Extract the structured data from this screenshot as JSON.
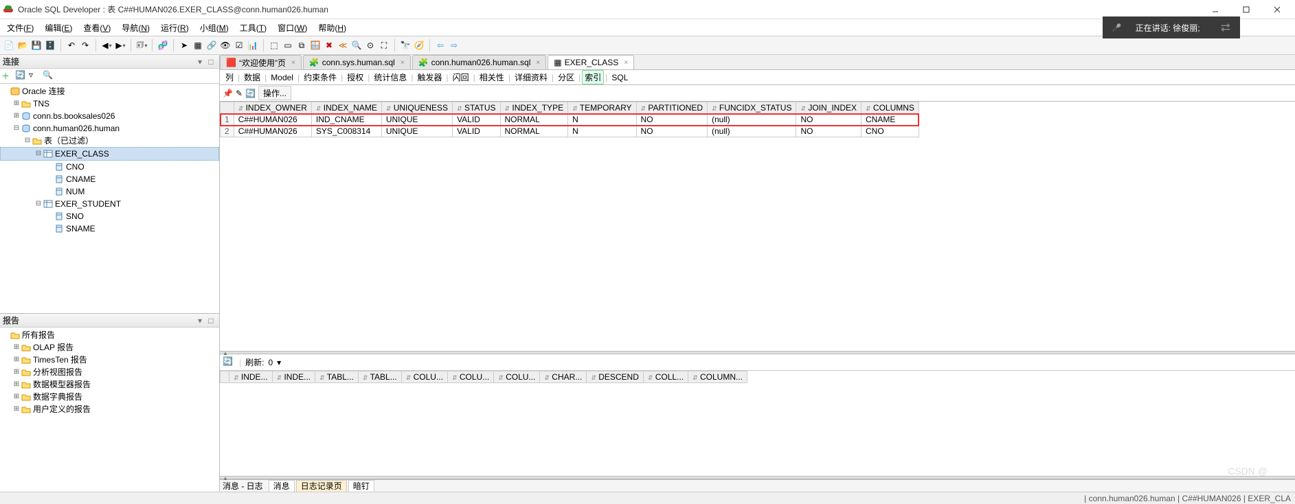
{
  "window": {
    "title": "Oracle SQL Developer : 表 C##HUMAN026.EXER_CLASS@conn.human026.human"
  },
  "speaking": {
    "label": "正在讲话: 徐俊丽;"
  },
  "menubar": [
    {
      "label": "文件",
      "ul": "F"
    },
    {
      "label": "编辑",
      "ul": "E"
    },
    {
      "label": "查看",
      "ul": "V"
    },
    {
      "label": "导航",
      "ul": "N"
    },
    {
      "label": "运行",
      "ul": "R"
    },
    {
      "label": "小组",
      "ul": "M"
    },
    {
      "label": "工具",
      "ul": "T"
    },
    {
      "label": "窗口",
      "ul": "W"
    },
    {
      "label": "帮助",
      "ul": "H"
    }
  ],
  "leftTop": {
    "title": "连接",
    "tree": [
      {
        "pad": 0,
        "tw": "",
        "ic": "conn",
        "label": "Oracle 连接"
      },
      {
        "pad": 1,
        "tw": "+",
        "ic": "folder",
        "label": "TNS"
      },
      {
        "pad": 1,
        "tw": "+",
        "ic": "db",
        "label": "conn.bs.booksales026"
      },
      {
        "pad": 1,
        "tw": "-",
        "ic": "db",
        "label": "conn.human026.human"
      },
      {
        "pad": 2,
        "tw": "-",
        "ic": "folder",
        "label": "表（已过滤）"
      },
      {
        "pad": 3,
        "tw": "-",
        "ic": "table",
        "label": "EXER_CLASS",
        "sel": true
      },
      {
        "pad": 4,
        "tw": "",
        "ic": "col",
        "label": "CNO"
      },
      {
        "pad": 4,
        "tw": "",
        "ic": "col",
        "label": "CNAME"
      },
      {
        "pad": 4,
        "tw": "",
        "ic": "col",
        "label": "NUM"
      },
      {
        "pad": 3,
        "tw": "-",
        "ic": "table",
        "label": "EXER_STUDENT"
      },
      {
        "pad": 4,
        "tw": "",
        "ic": "col",
        "label": "SNO"
      },
      {
        "pad": 4,
        "tw": "",
        "ic": "col",
        "label": "SNAME"
      }
    ]
  },
  "leftBot": {
    "title": "报告",
    "tree": [
      {
        "pad": 0,
        "tw": "",
        "ic": "folder",
        "label": "所有报告"
      },
      {
        "pad": 1,
        "tw": "+",
        "ic": "folder",
        "label": "OLAP 报告"
      },
      {
        "pad": 1,
        "tw": "+",
        "ic": "folder",
        "label": "TimesTen 报告"
      },
      {
        "pad": 1,
        "tw": "+",
        "ic": "folder",
        "label": "分析视图报告"
      },
      {
        "pad": 1,
        "tw": "+",
        "ic": "folder",
        "label": "数据模型器报告"
      },
      {
        "pad": 1,
        "tw": "+",
        "ic": "folder",
        "label": "数据字典报告"
      },
      {
        "pad": 1,
        "tw": "+",
        "ic": "folder",
        "label": "用户定义的报告"
      }
    ]
  },
  "doctabs": [
    {
      "ic": "start",
      "label": "“欢迎使用”页",
      "active": false
    },
    {
      "ic": "sql",
      "label": "conn.sys.human.sql",
      "active": false
    },
    {
      "ic": "sql",
      "label": "conn.human026.human.sql",
      "active": false
    },
    {
      "ic": "table",
      "label": "EXER_CLASS",
      "active": true
    }
  ],
  "subtabs": [
    "列",
    "数据",
    "Model",
    "约束条件",
    "授权",
    "统计信息",
    "触发器",
    "闪回",
    "相关性",
    "详细资料",
    "分区",
    "索引",
    "SQL"
  ],
  "subtab_active": "索引",
  "action_label": "操作...",
  "grid": {
    "cols": [
      "INDEX_OWNER",
      "INDEX_NAME",
      "UNIQUENESS",
      "STATUS",
      "INDEX_TYPE",
      "TEMPORARY",
      "PARTITIONED",
      "FUNCIDX_STATUS",
      "JOIN_INDEX",
      "COLUMNS"
    ],
    "rows": [
      {
        "n": 1,
        "hl": true,
        "cells": [
          "C##HUMAN026",
          "IND_CNAME",
          "UNIQUE",
          "VALID",
          "NORMAL",
          "N",
          "NO",
          "(null)",
          "NO",
          "CNAME"
        ]
      },
      {
        "n": 2,
        "hl": false,
        "cells": [
          "C##HUMAN026",
          "SYS_C008314",
          "UNIQUE",
          "VALID",
          "NORMAL",
          "N",
          "NO",
          "(null)",
          "NO",
          "CNO"
        ]
      }
    ]
  },
  "bottom": {
    "refresh_label": "刷新:",
    "refresh_val": "0",
    "cols": [
      "INDE...",
      "INDE...",
      "TABL...",
      "TABL...",
      "COLU...",
      "COLU...",
      "COLU...",
      "CHAR...",
      "DESCEND",
      "COLL...",
      "COLUMN..."
    ]
  },
  "msgbar": {
    "title": "消息 - 日志",
    "tabs": [
      "消息",
      "日志记录页",
      "暗钉"
    ],
    "active": 1
  },
  "status": {
    "text": "| conn.human026.human | C##HUMAN026 | EXER_CLA"
  }
}
